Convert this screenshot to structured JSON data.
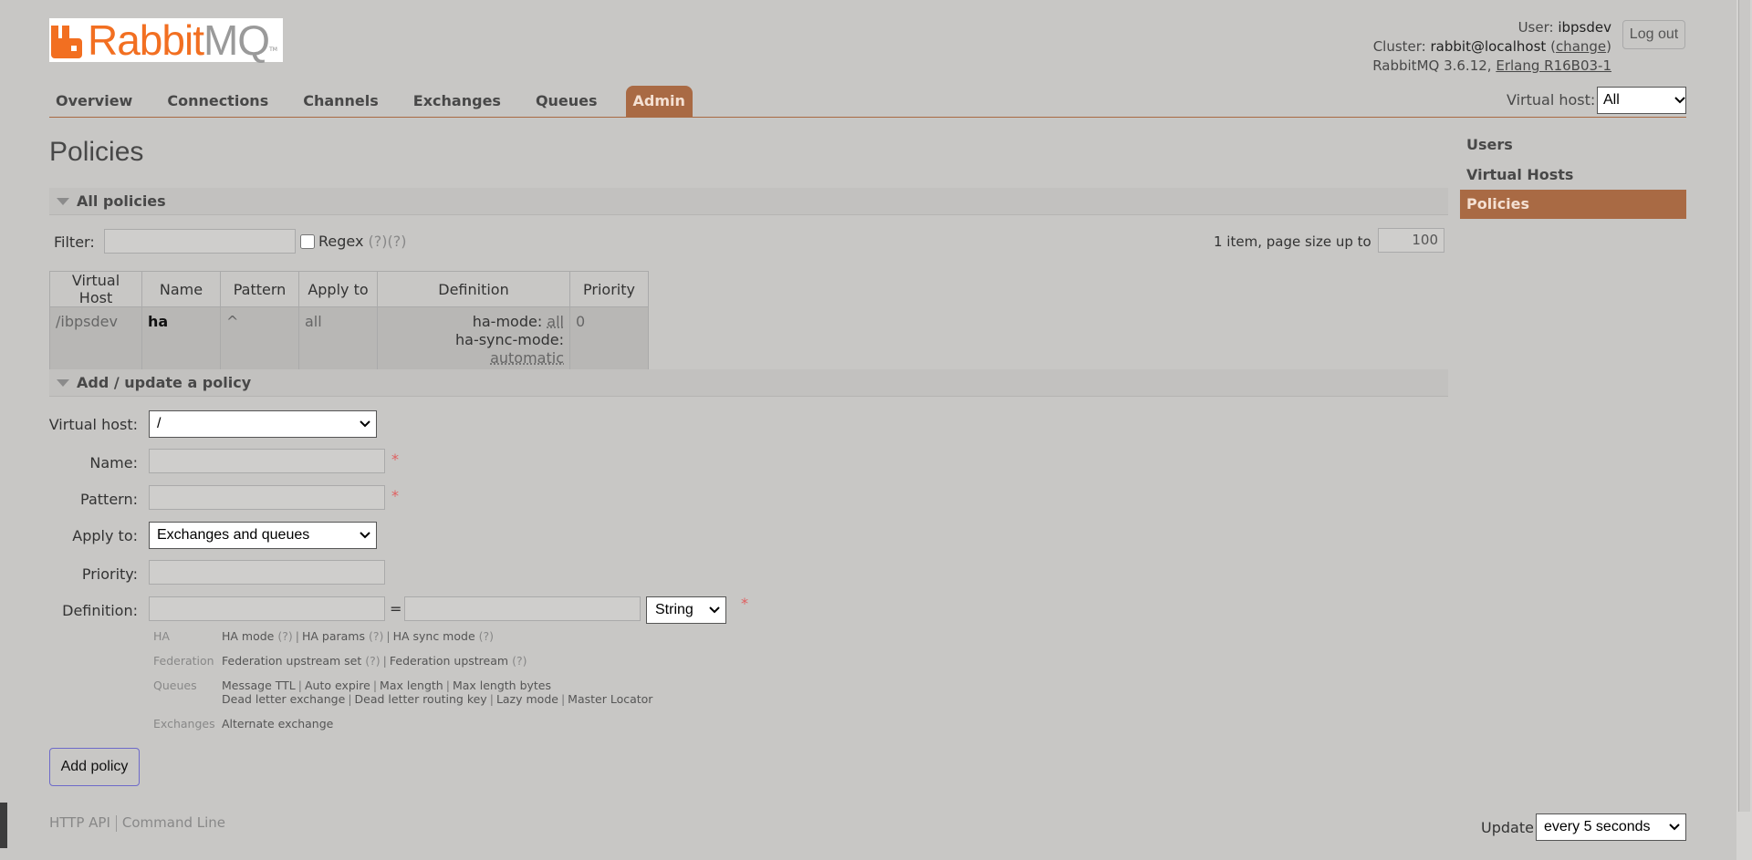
{
  "brand": {
    "rabbit": "Rabbit",
    "mq": "MQ",
    "tm": "TM",
    "accent": "#f26f21"
  },
  "header": {
    "user_label": "User:",
    "user": "ibpsdev",
    "cluster_label": "Cluster:",
    "cluster": "rabbit@localhost",
    "change_open": "(",
    "change": "change",
    "change_close": ")",
    "version_prefix": "RabbitMQ 3.6.12,",
    "erlang": "Erlang R16B03-1",
    "logout": "Log out",
    "virtual_host_label": "Virtual host:",
    "virtual_host_value": "All"
  },
  "nav": {
    "overview": "Overview",
    "connections": "Connections",
    "channels": "Channels",
    "exchanges": "Exchanges",
    "queues": "Queues",
    "admin": "Admin"
  },
  "page_title": "Policies",
  "sidebar": {
    "users": "Users",
    "virtual_hosts": "Virtual Hosts",
    "policies": "Policies"
  },
  "all_policies": {
    "heading": "All policies",
    "filter_label": "Filter:",
    "filter_value": "",
    "regex_label": "Regex",
    "regex_help": "(?)(?)",
    "paging_text": "1 item, page size up to",
    "page_size": "100",
    "columns": [
      "Virtual Host",
      "Name",
      "Pattern",
      "Apply to",
      "Definition",
      "Priority"
    ],
    "rows": [
      {
        "vhost": "/ibpsdev",
        "name": "ha",
        "pattern": "^",
        "apply_to": "all",
        "def_key1": "ha-mode:",
        "def_val1": "all",
        "def_key2": "ha-sync-mode:",
        "def_val2": "automatic",
        "priority": "0"
      }
    ]
  },
  "add_policy": {
    "heading": "Add / update a policy",
    "virtual_host_label": "Virtual host:",
    "virtual_host_value": "/",
    "name_label": "Name:",
    "name_value": "",
    "pattern_label": "Pattern:",
    "pattern_value": "",
    "apply_to_label": "Apply to:",
    "apply_to_value": "Exchanges and queues",
    "priority_label": "Priority:",
    "priority_value": "",
    "definition_label": "Definition:",
    "definition_key": "",
    "equals": "=",
    "definition_value": "",
    "definition_type": "String",
    "required_mark": "*",
    "help": {
      "ha_cat": "HA",
      "ha_mode": "HA mode",
      "ha_params": "HA params",
      "ha_sync_mode": "HA sync mode",
      "q": "(?)",
      "federation_cat": "Federation",
      "fed_upstream_set": "Federation upstream set",
      "fed_upstream": "Federation upstream",
      "queues_cat": "Queues",
      "message_ttl": "Message TTL",
      "auto_expire": "Auto expire",
      "max_length": "Max length",
      "max_length_bytes": "Max length bytes",
      "dead_letter_exchange": "Dead letter exchange",
      "dead_letter_routing_key": "Dead letter routing key",
      "lazy_mode": "Lazy mode",
      "master_locator": "Master Locator",
      "exchanges_cat": "Exchanges",
      "alternate_exchange": "Alternate exchange",
      "sep": "|"
    },
    "submit": "Add policy"
  },
  "footer": {
    "http_api": "HTTP API",
    "command_line": "Command Line",
    "update_label": "Update",
    "update_value": "every 5 seconds"
  }
}
